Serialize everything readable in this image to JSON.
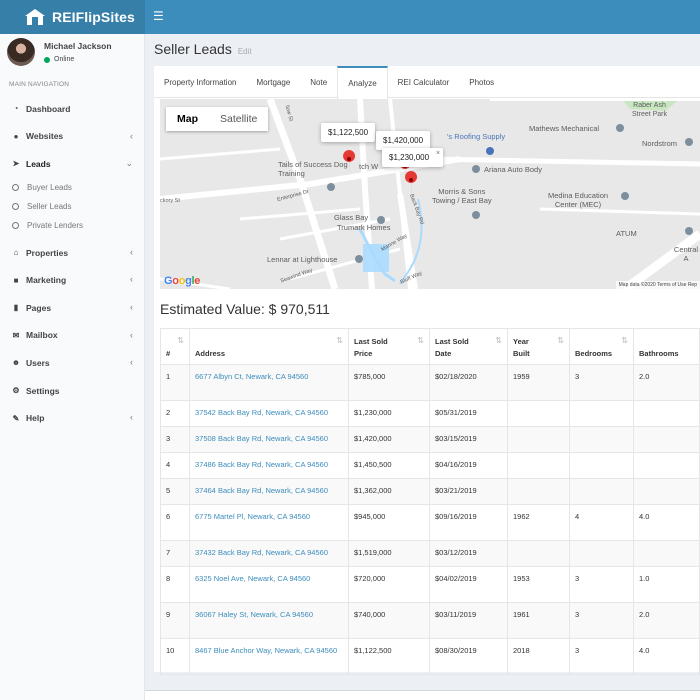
{
  "app": {
    "title": "REIFlipSites"
  },
  "user": {
    "name": "Michael Jackson",
    "status": "Online"
  },
  "sidebar": {
    "header": "MAIN NAVIGATION",
    "items": [
      {
        "label": "Dashboard",
        "icon": "dashboard-icon"
      },
      {
        "label": "Websites",
        "icon": "globe-icon"
      },
      {
        "label": "Leads",
        "icon": "location-arrow-icon"
      },
      {
        "label": "Properties",
        "icon": "home-icon"
      },
      {
        "label": "Marketing",
        "icon": "briefcase-icon"
      },
      {
        "label": "Pages",
        "icon": "file-icon"
      },
      {
        "label": "Mailbox",
        "icon": "envelope-icon"
      },
      {
        "label": "Users",
        "icon": "users-icon"
      },
      {
        "label": "Settings",
        "icon": "cogs-icon"
      },
      {
        "label": "Help",
        "icon": "wrench-icon"
      }
    ],
    "leads_sub": [
      "Buyer Leads",
      "Seller Leads",
      "Private Lenders"
    ]
  },
  "page": {
    "title": "Seller Leads",
    "edit": "Edit"
  },
  "tabs": [
    "Property Information",
    "Mortgage",
    "Note",
    "Analyze",
    "REI Calculator",
    "Photos"
  ],
  "map": {
    "toggle": [
      "Map",
      "Satellite"
    ],
    "tips": [
      "$1,122,500",
      "$1,420,000",
      "$1,230,000"
    ],
    "labels": {
      "supply": "'s Roofing Supply",
      "mathews": "Mathews Mechanical",
      "park": "Raber Ash\nStreet Park",
      "nordstrom": "Nordstrom",
      "ariana": "Ariana Auto Body",
      "tails": "Tails of Success Dog Training",
      "tails2": "tch W",
      "morris": "Morris & Sons\nTowing / East Bay",
      "medina": "Medina Education\nCenter (MEC)",
      "atum": "ATUM",
      "glass": "Glass Bay",
      "trumark": "Trumark Homes",
      "lennar": "Lennar at Lighthouse",
      "central": "Central A",
      "enterprise": "Enterprise Dr",
      "backbay": "Back Bay Rd",
      "marine": "Marine Way",
      "seawind": "Seawind Way",
      "bluff": "Bluff Way",
      "willow": "llow St",
      "hickory": "ckory St"
    },
    "google": "Google",
    "attribution": "Map data ©2020  Terms of Use  Rep"
  },
  "estimated": {
    "label": "Estimated Value: $ 970,511"
  },
  "table": {
    "headers": [
      "#",
      "Address",
      "Last Sold Price",
      "Last Sold Date",
      "Year Built",
      "Bedrooms",
      "Bathrooms"
    ],
    "rows": [
      [
        "1",
        "6677 Albyn Ct, Newark, CA 94560",
        "$785,000",
        "$02/18/2020",
        "1959",
        "3",
        "2.0"
      ],
      [
        "2",
        "37542 Back Bay Rd, Newark, CA 94560",
        "$1,230,000",
        "$05/31/2019",
        "",
        "",
        ""
      ],
      [
        "3",
        "37508 Back Bay Rd, Newark, CA 94560",
        "$1,420,000",
        "$03/15/2019",
        "",
        "",
        ""
      ],
      [
        "4",
        "37486 Back Bay Rd, Newark, CA 94560",
        "$1,450,500",
        "$04/16/2019",
        "",
        "",
        ""
      ],
      [
        "5",
        "37464 Back Bay Rd, Newark, CA 94560",
        "$1,362,000",
        "$03/21/2019",
        "",
        "",
        ""
      ],
      [
        "6",
        "6775 Martel Pl, Newark, CA 94560",
        "$945,000",
        "$09/16/2019",
        "1962",
        "4",
        "4.0"
      ],
      [
        "7",
        "37432 Back Bay Rd, Newark, CA 94560",
        "$1,519,000",
        "$03/12/2019",
        "",
        "",
        ""
      ],
      [
        "8",
        "6325 Noel Ave, Newark, CA 94560",
        "$720,000",
        "$04/02/2019",
        "1953",
        "3",
        "1.0"
      ],
      [
        "9",
        "36067 Haley St, Newark, CA 94560",
        "$740,000",
        "$03/11/2019",
        "1961",
        "3",
        "2.0"
      ],
      [
        "10",
        "8467 Blue Anchor Way, Newark, CA 94560",
        "$1,122,500",
        "$08/30/2019",
        "2018",
        "3",
        "4.0"
      ]
    ]
  },
  "colors": {
    "header": "#3c8dbc",
    "logo_bg": "#367fa9",
    "link": "#3c8dbc",
    "online": "#00a65a",
    "pin": "#e53935"
  }
}
